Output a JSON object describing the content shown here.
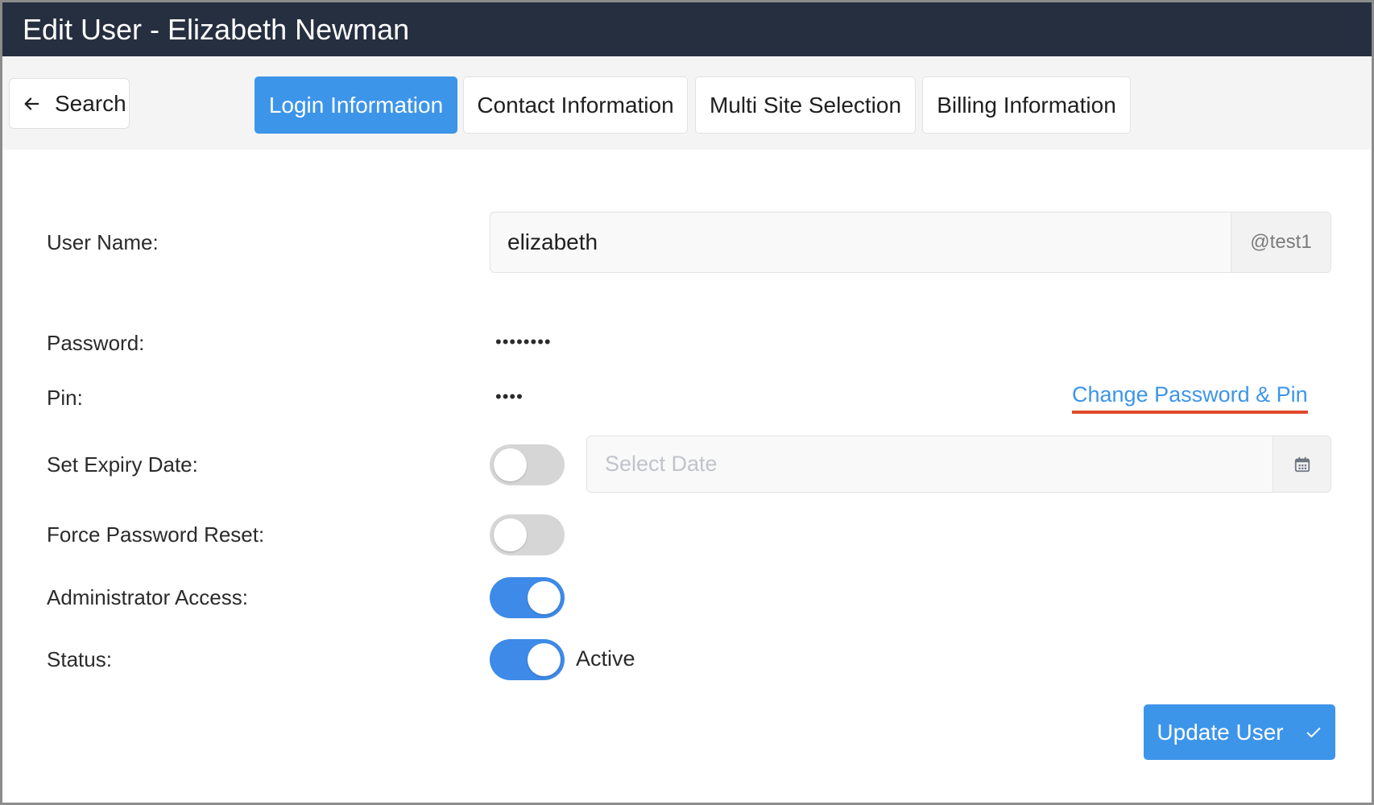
{
  "header": {
    "title": "Edit User - Elizabeth Newman"
  },
  "nav": {
    "back_label": "Search",
    "tabs": [
      {
        "label": "Login Information",
        "active": true
      },
      {
        "label": "Contact Information",
        "active": false
      },
      {
        "label": "Multi Site Selection",
        "active": false
      },
      {
        "label": "Billing Information",
        "active": false
      }
    ]
  },
  "form": {
    "username": {
      "label": "User Name:",
      "value": "elizabeth",
      "suffix": "@test1"
    },
    "password": {
      "label": "Password:",
      "value": "••••••••"
    },
    "pin": {
      "label": "Pin:",
      "value": "••••"
    },
    "change_link": "Change Password & Pin",
    "expiry": {
      "label": "Set Expiry Date:",
      "enabled": false,
      "placeholder": "Select Date"
    },
    "force_reset": {
      "label": "Force Password Reset:",
      "enabled": false
    },
    "admin": {
      "label": "Administrator Access:",
      "enabled": true
    },
    "status": {
      "label": "Status:",
      "enabled": true,
      "text": "Active"
    }
  },
  "actions": {
    "update_label": "Update User"
  },
  "colors": {
    "header_bg": "#262f40",
    "accent": "#3d95ea",
    "link_underline": "#e04a2f",
    "toggle_off": "#d6d6d6"
  },
  "icons": {
    "back": "arrow-left-icon",
    "calendar": "calendar-icon",
    "update": "check-icon"
  }
}
